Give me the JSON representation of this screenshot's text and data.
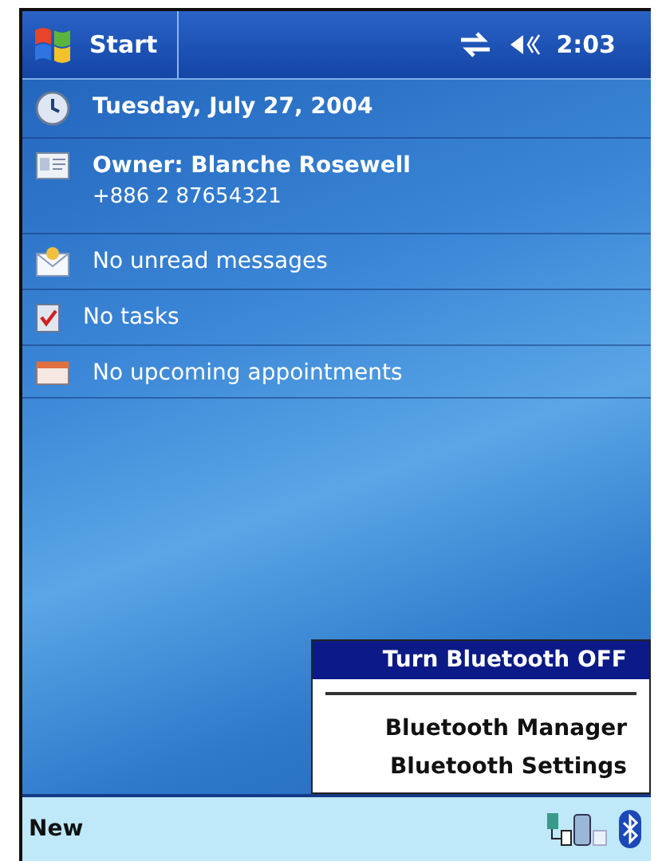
{
  "title_bar": {
    "label": "Start",
    "time": "2:03"
  },
  "today_items": [
    {
      "kind": "date",
      "title": "Tuesday, July 27, 2004"
    },
    {
      "kind": "owner",
      "title": "Owner: Blanche Rosewell",
      "subtitle": "+886 2 87654321"
    },
    {
      "kind": "messages",
      "title": "No unread messages"
    },
    {
      "kind": "tasks",
      "title": "No tasks"
    },
    {
      "kind": "calendar",
      "title": "No upcoming appointments"
    }
  ],
  "popup_menu": [
    {
      "label": "Turn Bluetooth OFF",
      "selected": true,
      "separator_after": true
    },
    {
      "label": "Bluetooth Manager",
      "selected": false,
      "separator_after": false
    },
    {
      "label": "Bluetooth Settings",
      "selected": false,
      "separator_after": false
    }
  ],
  "bottom_bar": {
    "label": "New"
  }
}
